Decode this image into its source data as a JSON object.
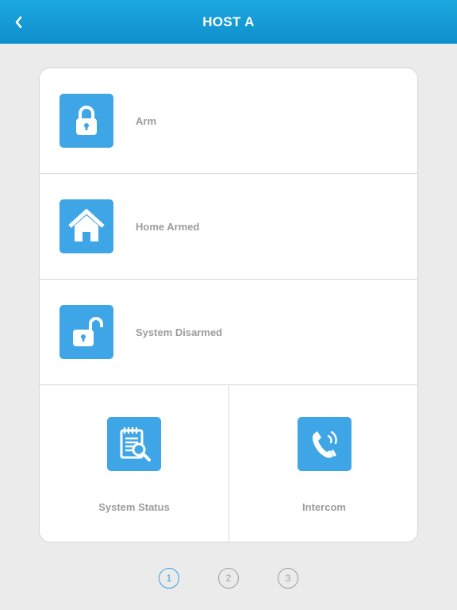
{
  "header": {
    "title": "HOST A",
    "back_icon": "chevron-left-icon"
  },
  "menu": {
    "items": [
      {
        "label": "Arm",
        "icon": "lock-closed-icon"
      },
      {
        "label": "Home Armed",
        "icon": "home-icon"
      },
      {
        "label": "System Disarmed",
        "icon": "lock-open-icon"
      }
    ],
    "tiles": [
      {
        "label": "System Status",
        "icon": "checklist-search-icon"
      },
      {
        "label": "Intercom",
        "icon": "phone-ringing-icon"
      }
    ]
  },
  "pager": {
    "pages": [
      "1",
      "2",
      "3"
    ],
    "current": "1"
  },
  "colors": {
    "header": "#1da7df",
    "icon_bg": "#3ea6e6",
    "label": "#9c9c9c",
    "active_page": "#3aa0dc"
  }
}
